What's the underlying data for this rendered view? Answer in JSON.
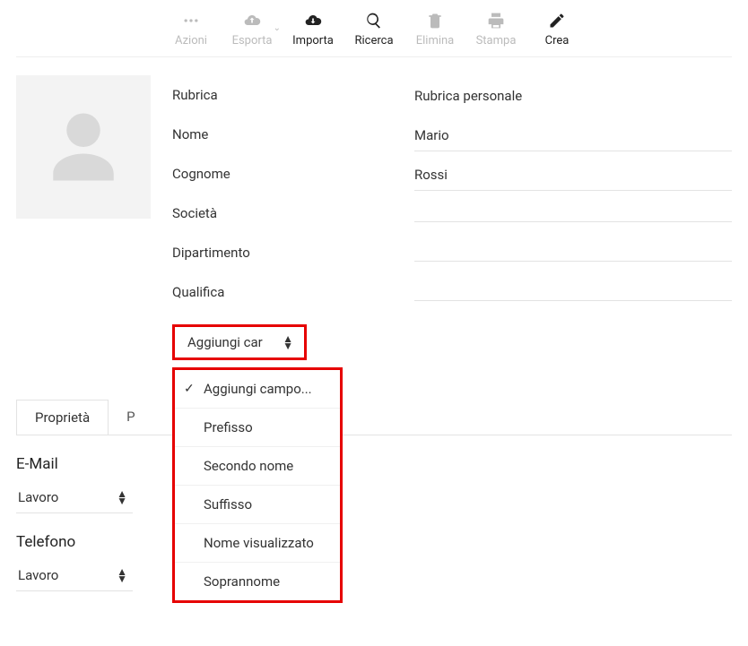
{
  "toolbar": {
    "actions": "Azioni",
    "export": "Esporta",
    "import": "Importa",
    "search": "Ricerca",
    "delete": "Elimina",
    "print": "Stampa",
    "create": "Crea"
  },
  "fields": {
    "addressbook_label": "Rubrica",
    "addressbook_value": "Rubrica personale",
    "firstname_label": "Nome",
    "firstname_value": "Mario",
    "lastname_label": "Cognome",
    "lastname_value": "Rossi",
    "company_label": "Società",
    "department_label": "Dipartimento",
    "title_label": "Qualifica"
  },
  "addfield": {
    "button": "Aggiungi car",
    "options": [
      "Aggiungi campo...",
      "Prefisso",
      "Secondo nome",
      "Suffisso",
      "Nome visualizzato",
      "Soprannome"
    ]
  },
  "tabs": {
    "properties": "Proprietà",
    "other": "P"
  },
  "sections": {
    "email": "E-Mail",
    "email_type": "Lavoro",
    "phone": "Telefono",
    "phone_type": "Lavoro"
  }
}
